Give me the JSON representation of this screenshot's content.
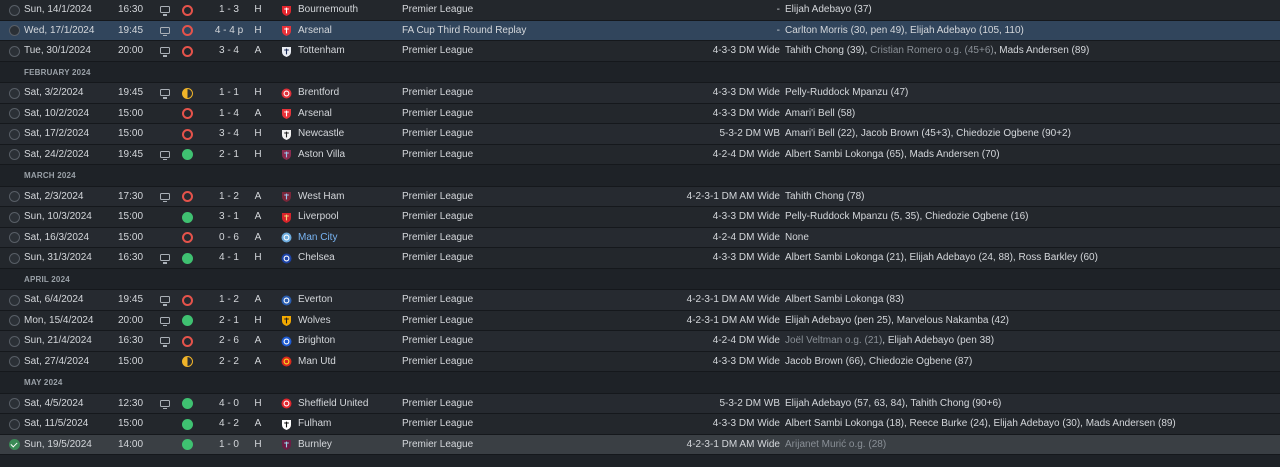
{
  "colors": {
    "win": "#3fc171",
    "loss": "#e5534b",
    "draw": "#f0b429",
    "selected_row": "#31455c",
    "link": "#78b4f2"
  },
  "sections": [
    {
      "header": "",
      "fixtures": [
        {
          "date": "Sun, 14/1/2024",
          "time": "16:30",
          "tv": true,
          "result": "L",
          "score": "1 - 3",
          "venue": "H",
          "opponent": "Bournemouth",
          "crest": "bournemouth-crest-icon",
          "competition": "Premier League",
          "formation": "-",
          "scorers": [
            {
              "t": "Elijah Adebayo (37)"
            }
          ]
        },
        {
          "date": "Wed, 17/1/2024",
          "time": "19:45",
          "tv": true,
          "result": "L",
          "score": "4 - 4 p",
          "venue": "H",
          "opponent": "Arsenal",
          "crest": "arsenal-crest-icon",
          "competition": "FA Cup Third Round Replay",
          "formation": "-",
          "selected": true,
          "scorers": [
            {
              "t": "Carlton Morris (30, pen 49), Elijah Adebayo (105, 110)"
            }
          ]
        },
        {
          "date": "Tue, 30/1/2024",
          "time": "20:00",
          "tv": true,
          "result": "L",
          "score": "3 - 4",
          "venue": "A",
          "opponent": "Tottenham",
          "crest": "tottenham-crest-icon",
          "competition": "Premier League",
          "formation": "4-3-3 DM Wide",
          "scorers": [
            {
              "t": "Tahith Chong (39), "
            },
            {
              "t": "Cristian Romero o.g. (45+6)",
              "og": true
            },
            {
              "t": ", Mads Andersen (89)"
            }
          ]
        }
      ]
    },
    {
      "header": "FEBRUARY 2024",
      "fixtures": [
        {
          "date": "Sat, 3/2/2024",
          "time": "19:45",
          "tv": true,
          "result": "D",
          "score": "1 - 1",
          "venue": "H",
          "opponent": "Brentford",
          "crest": "brentford-crest-icon",
          "competition": "Premier League",
          "formation": "4-3-3 DM Wide",
          "scorers": [
            {
              "t": "Pelly-Ruddock Mpanzu (47)"
            }
          ]
        },
        {
          "date": "Sat, 10/2/2024",
          "time": "15:00",
          "tv": false,
          "result": "L",
          "score": "1 - 4",
          "venue": "A",
          "opponent": "Arsenal",
          "crest": "arsenal-crest-icon",
          "competition": "Premier League",
          "formation": "4-3-3 DM Wide",
          "scorers": [
            {
              "t": "Amari'i Bell (58)"
            }
          ]
        },
        {
          "date": "Sat, 17/2/2024",
          "time": "15:00",
          "tv": false,
          "result": "L",
          "score": "3 - 4",
          "venue": "H",
          "opponent": "Newcastle",
          "crest": "newcastle-crest-icon",
          "competition": "Premier League",
          "formation": "5-3-2 DM WB",
          "scorers": [
            {
              "t": "Amari'i Bell (22), Jacob Brown (45+3), Chiedozie Ogbene (90+2)"
            }
          ]
        },
        {
          "date": "Sat, 24/2/2024",
          "time": "19:45",
          "tv": true,
          "result": "W",
          "score": "2 - 1",
          "venue": "H",
          "opponent": "Aston Villa",
          "crest": "aston-villa-crest-icon",
          "competition": "Premier League",
          "formation": "4-2-4 DM Wide",
          "scorers": [
            {
              "t": "Albert Sambi Lokonga (65), Mads Andersen (70)"
            }
          ]
        }
      ]
    },
    {
      "header": "MARCH 2024",
      "fixtures": [
        {
          "date": "Sat, 2/3/2024",
          "time": "17:30",
          "tv": true,
          "result": "L",
          "score": "1 - 2",
          "venue": "A",
          "opponent": "West Ham",
          "crest": "west-ham-crest-icon",
          "competition": "Premier League",
          "formation": "4-2-3-1 DM AM Wide",
          "scorers": [
            {
              "t": "Tahith Chong (78)"
            }
          ]
        },
        {
          "date": "Sun, 10/3/2024",
          "time": "15:00",
          "tv": false,
          "result": "W",
          "score": "3 - 1",
          "venue": "A",
          "opponent": "Liverpool",
          "crest": "liverpool-crest-icon",
          "competition": "Premier League",
          "formation": "4-3-3 DM Wide",
          "scorers": [
            {
              "t": "Pelly-Ruddock Mpanzu (5, 35), Chiedozie Ogbene (16)"
            }
          ]
        },
        {
          "date": "Sat, 16/3/2024",
          "time": "15:00",
          "tv": false,
          "result": "L",
          "score": "0 - 6",
          "venue": "A",
          "opponent": "Man City",
          "crest": "man-city-crest-icon",
          "competition": "Premier League",
          "formation": "4-2-4 DM Wide",
          "opponent_highlight": true,
          "scorers": [
            {
              "t": "None"
            }
          ]
        },
        {
          "date": "Sun, 31/3/2024",
          "time": "16:30",
          "tv": true,
          "result": "W",
          "score": "4 - 1",
          "venue": "H",
          "opponent": "Chelsea",
          "crest": "chelsea-crest-icon",
          "competition": "Premier League",
          "formation": "4-3-3 DM Wide",
          "scorers": [
            {
              "t": "Albert Sambi Lokonga (21), Elijah Adebayo (24, 88), Ross Barkley (60)"
            }
          ]
        }
      ]
    },
    {
      "header": "APRIL 2024",
      "fixtures": [
        {
          "date": "Sat, 6/4/2024",
          "time": "19:45",
          "tv": true,
          "result": "L",
          "score": "1 - 2",
          "venue": "A",
          "opponent": "Everton",
          "crest": "everton-crest-icon",
          "competition": "Premier League",
          "formation": "4-2-3-1 DM AM Wide",
          "scorers": [
            {
              "t": "Albert Sambi Lokonga (83)"
            }
          ]
        },
        {
          "date": "Mon, 15/4/2024",
          "time": "20:00",
          "tv": true,
          "result": "W",
          "score": "2 - 1",
          "venue": "H",
          "opponent": "Wolves",
          "crest": "wolves-crest-icon",
          "competition": "Premier League",
          "formation": "4-2-3-1 DM AM Wide",
          "scorers": [
            {
              "t": "Elijah Adebayo (pen 25), Marvelous Nakamba (42)"
            }
          ]
        },
        {
          "date": "Sun, 21/4/2024",
          "time": "16:30",
          "tv": true,
          "result": "L",
          "score": "2 - 6",
          "venue": "A",
          "opponent": "Brighton",
          "crest": "brighton-crest-icon",
          "competition": "Premier League",
          "formation": "4-2-4 DM Wide",
          "scorers": [
            {
              "t": "Joël Veltman o.g. (21)",
              "og": true
            },
            {
              "t": ", Elijah Adebayo (pen 38)"
            }
          ]
        },
        {
          "date": "Sat, 27/4/2024",
          "time": "15:00",
          "tv": false,
          "result": "D",
          "score": "2 - 2",
          "venue": "A",
          "opponent": "Man Utd",
          "crest": "man-utd-crest-icon",
          "competition": "Premier League",
          "formation": "4-3-3 DM Wide",
          "scorers": [
            {
              "t": "Jacob Brown (66), Chiedozie Ogbene (87)"
            }
          ]
        }
      ]
    },
    {
      "header": "MAY 2024",
      "fixtures": [
        {
          "date": "Sat, 4/5/2024",
          "time": "12:30",
          "tv": true,
          "result": "W",
          "score": "4 - 0",
          "venue": "H",
          "opponent": "Sheffield United",
          "crest": "sheffield-united-crest-icon",
          "competition": "Premier League",
          "formation": "5-3-2 DM WB",
          "scorers": [
            {
              "t": "Elijah Adebayo (57, 63, 84), Tahith Chong (90+6)"
            }
          ]
        },
        {
          "date": "Sat, 11/5/2024",
          "time": "15:00",
          "tv": false,
          "result": "W",
          "score": "4 - 2",
          "venue": "A",
          "opponent": "Fulham",
          "crest": "fulham-crest-icon",
          "competition": "Premier League",
          "formation": "4-3-3 DM Wide",
          "scorers": [
            {
              "t": "Albert Sambi Lokonga (18), Reece Burke (24), Elijah Adebayo (30), Mads Andersen (89)"
            }
          ]
        },
        {
          "date": "Sun, 19/5/2024",
          "time": "14:00",
          "tv": false,
          "result": "W",
          "score": "1 - 0",
          "venue": "H",
          "opponent": "Burnley",
          "crest": "burnley-crest-icon",
          "competition": "Premier League",
          "formation": "4-2-3-1 DM AM Wide",
          "current": true,
          "scorers": [
            {
              "t": "Arijanet Murić o.g. (28)",
              "og": true
            }
          ]
        }
      ]
    }
  ]
}
